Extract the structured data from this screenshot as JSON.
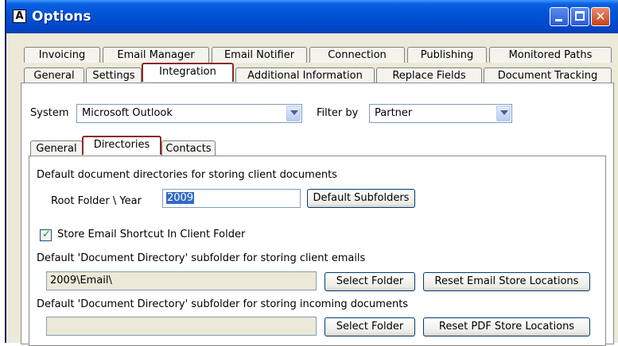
{
  "window": {
    "title": "Options",
    "app_icon_glyph": "Ā"
  },
  "titlebar_buttons": {
    "minimize": "minimize-icon",
    "maximize": "maximize-icon",
    "close_glyph": "✕"
  },
  "tabs_row1": [
    "Invoicing",
    "Email Manager",
    "Email Notifier",
    "Connection",
    "Publishing",
    "Monitored Paths"
  ],
  "tabs_row2": [
    "General",
    "Settings",
    "Integration",
    "Additional Information",
    "Replace Fields",
    "Document Tracking"
  ],
  "integration": {
    "system_label": "System",
    "system_value": "Microsoft Outlook",
    "filter_label": "Filter by",
    "filter_value": "Partner",
    "subtabs": [
      "General",
      "Directories",
      "Contacts"
    ],
    "directories": {
      "heading": "Default document directories for storing client documents",
      "root_label": "Root Folder \\ Year",
      "root_value": "2009",
      "default_subfolders_button": "Default Subfolders",
      "store_shortcut_label": "Store Email Shortcut In Client Folder",
      "store_shortcut_checked": true,
      "email_subfolder_label": "Default 'Document Directory' subfolder for storing client emails",
      "email_subfolder_value": "2009\\Email\\",
      "select_folder_button": "Select Folder",
      "reset_email_button": "Reset Email Store Locations",
      "incoming_subfolder_label": "Default 'Document Directory' subfolder for storing incoming documents",
      "incoming_subfolder_value": "",
      "select_folder_button_2": "Select Folder",
      "reset_pdf_button": "Reset PDF Store Locations"
    }
  },
  "colors": {
    "titlebar": "#0052d6",
    "highlight": "#8a2a2a",
    "face": "#ece9d8",
    "selection": "#316ac5"
  }
}
